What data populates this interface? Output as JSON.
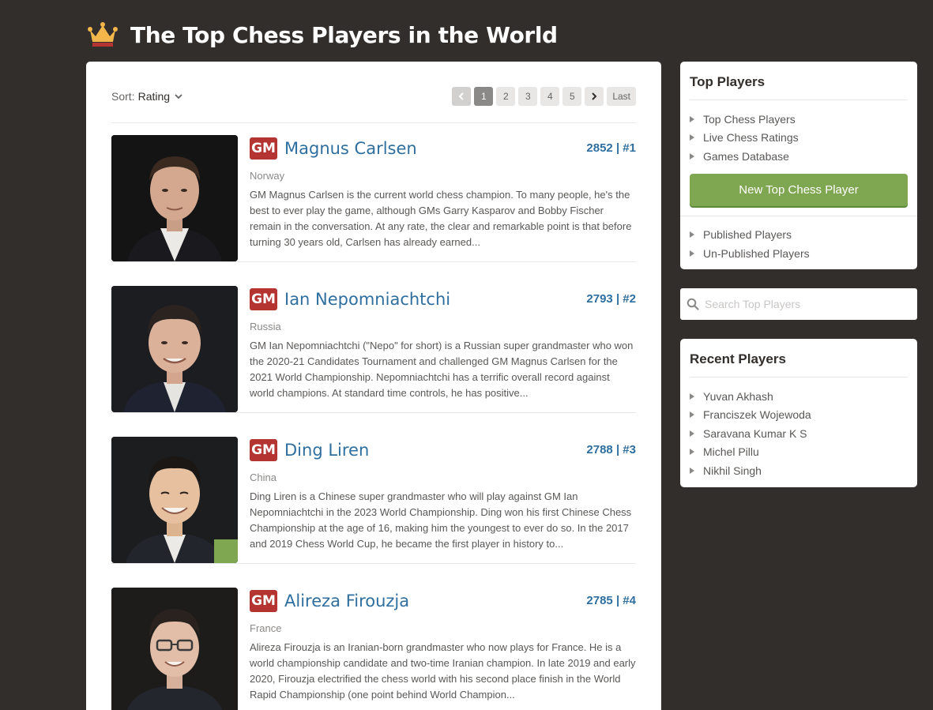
{
  "header": {
    "title": "The Top Chess Players in the World",
    "icon": "crown-icon",
    "icon_color": "#f2b64a"
  },
  "toolbar": {
    "sort_label": "Sort:",
    "sort_value": "Rating",
    "pages": [
      "1",
      "2",
      "3",
      "4",
      "5"
    ],
    "last_label": "Last",
    "current_page": "1"
  },
  "players": [
    {
      "title": "GM",
      "name": "Magnus Carlsen",
      "rating_rank": "2852 | #1",
      "country": "Norway",
      "bio": "GM Magnus Carlsen is the current world chess champion. To many people, he's the best to ever play the game, although GMs Garry Kasparov and Bobby Fischer remain in the conversation. At any rate, the clear and remarkable point is that before turning 30 years old, Carlsen has already earned..."
    },
    {
      "title": "GM",
      "name": "Ian Nepomniachtchi",
      "rating_rank": "2793 | #2",
      "country": "Russia",
      "bio": "GM Ian Nepomniachtchi (\"Nepo\" for short) is a Russian super grandmaster who won the 2020-21 Candidates Tournament and challenged GM Magnus Carlsen for the 2021 World Championship. Nepomniachtchi has a terrific overall record against world champions. At standard time controls, he has positive..."
    },
    {
      "title": "GM",
      "name": "Ding Liren",
      "rating_rank": "2788 | #3",
      "country": "China",
      "bio": "Ding Liren is a Chinese super grandmaster who will play against GM Ian Nepomniachtchi in the 2023 World Championship. Ding won his first Chinese Chess Championship at the age of 16, making him the youngest to ever do so. In the 2017 and 2019 Chess World Cup, he became the first player in history to..."
    },
    {
      "title": "GM",
      "name": "Alireza Firouzja",
      "rating_rank": "2785 | #4",
      "country": "France",
      "bio": "Alireza Firouzja is an Iranian-born grandmaster who now plays for France. He is a world championship candidate and two-time Iranian champion. In late 2019 and early 2020, Firouzja electrified the chess world with his second place finish in the World Rapid Championship (one point behind World Champion..."
    }
  ],
  "sidebar": {
    "top_players": {
      "title": "Top Players",
      "links": [
        "Top Chess Players",
        "Live Chess Ratings",
        "Games Database"
      ],
      "button_label": "New Top Chess Player",
      "links2": [
        "Published Players",
        "Un-Published Players"
      ]
    },
    "search": {
      "placeholder": "Search Top Players"
    },
    "recent_players": {
      "title": "Recent Players",
      "links": [
        "Yuvan Akhash",
        "Franciszek Wojewoda",
        "Saravana Kumar K S",
        "Michel Pillu",
        "Nikhil Singh"
      ]
    }
  },
  "colors": {
    "background": "#312e2b",
    "badge": "#b33430",
    "link": "#2f6f9f",
    "button": "#7fa650"
  }
}
